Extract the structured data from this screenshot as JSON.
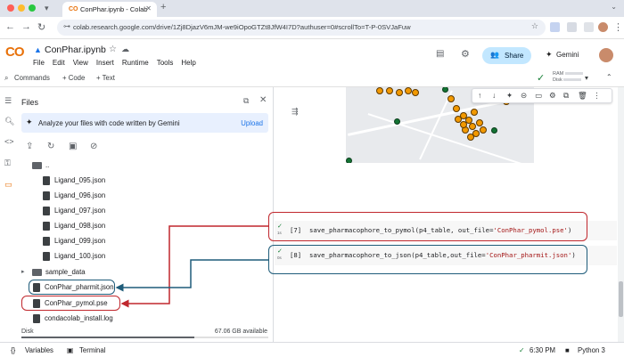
{
  "browser": {
    "tab_title": "ConPhar.ipynb - Colab",
    "tab_favicon": "CO",
    "new_tab": "+",
    "url": "colab.research.google.com/drive/1Zj8DjazV6mJM-we9iOpoGTZt8JfW4I7D?authuser=0#scrollTo=T-P-0SVJaFuw",
    "colors": {
      "close": "#ff5f57",
      "minimize": "#febc2e",
      "maximize": "#28c840"
    }
  },
  "colab": {
    "logo": "CO",
    "notebook_title": "ConPhar.ipynb",
    "menu": [
      "File",
      "Edit",
      "View",
      "Insert",
      "Runtime",
      "Tools",
      "Help"
    ],
    "share_label": "Share",
    "gemini_label": "Gemini",
    "commands_label": "Commands",
    "add_code": "+ Code",
    "add_text": "+ Text",
    "ram_label": "RAM",
    "disk_label": "Disk"
  },
  "files": {
    "title": "Files",
    "gemini_prompt": "Analyze your files with code written by Gemini",
    "upload_label": "Upload",
    "parent_folder": "..",
    "items": [
      "Ligand_095.json",
      "Ligand_096.json",
      "Ligand_097.json",
      "Ligand_098.json",
      "Ligand_099.json",
      "Ligand_100.json"
    ],
    "folder": "sample_data",
    "root_files": [
      "ConPhar_pharmit.json",
      "ConPhar_pymol.pse",
      "condacolab_install.log"
    ],
    "disk_label": "Disk",
    "disk_available": "67.06 GB available"
  },
  "cells": [
    {
      "exec": "[7]",
      "run_time": "1s",
      "code_prefix": "save_pharmacophore_to_pymol(p4_table, out_file=",
      "code_string": "'ConPhar_pymol.pse'",
      "code_suffix": ")"
    },
    {
      "exec": "[8]",
      "run_time": "0s",
      "code_prefix": "save_pharmacophore_to_json(p4_table,out_file=",
      "code_string": "'ConPhar_pharmit.json'",
      "code_suffix": ")"
    }
  ],
  "statusbar": {
    "variables": "Variables",
    "terminal": "Terminal",
    "time": "6:30 PM",
    "runtime": "Python 3"
  },
  "annotation_colors": {
    "red": "#c0272d",
    "blue": "#1f5c7a"
  }
}
